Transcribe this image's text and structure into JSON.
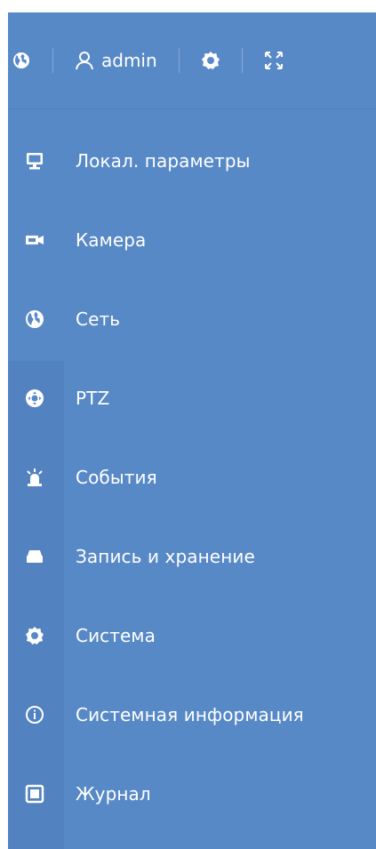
{
  "header": {
    "username": "admin",
    "icons": [
      "globe-icon",
      "user-icon",
      "settings-icon",
      "fullscreen-icon"
    ]
  },
  "menu": {
    "items": [
      {
        "label": "Локал. параметры",
        "icon": "monitor-icon"
      },
      {
        "label": "Камера",
        "icon": "camera-icon"
      },
      {
        "label": "Сеть",
        "icon": "globe-icon"
      },
      {
        "label": "PTZ",
        "icon": "ptz-icon"
      },
      {
        "label": "События",
        "icon": "alarm-icon"
      },
      {
        "label": "Запись и хранение",
        "icon": "storage-icon"
      },
      {
        "label": "Система",
        "icon": "gear-icon"
      },
      {
        "label": "Системная информация",
        "icon": "info-icon"
      },
      {
        "label": "Журнал",
        "icon": "log-icon"
      }
    ]
  },
  "colors": {
    "panel_bg": "#5889c7",
    "strip_bg": "#5282c0",
    "text": "#ffffff"
  }
}
